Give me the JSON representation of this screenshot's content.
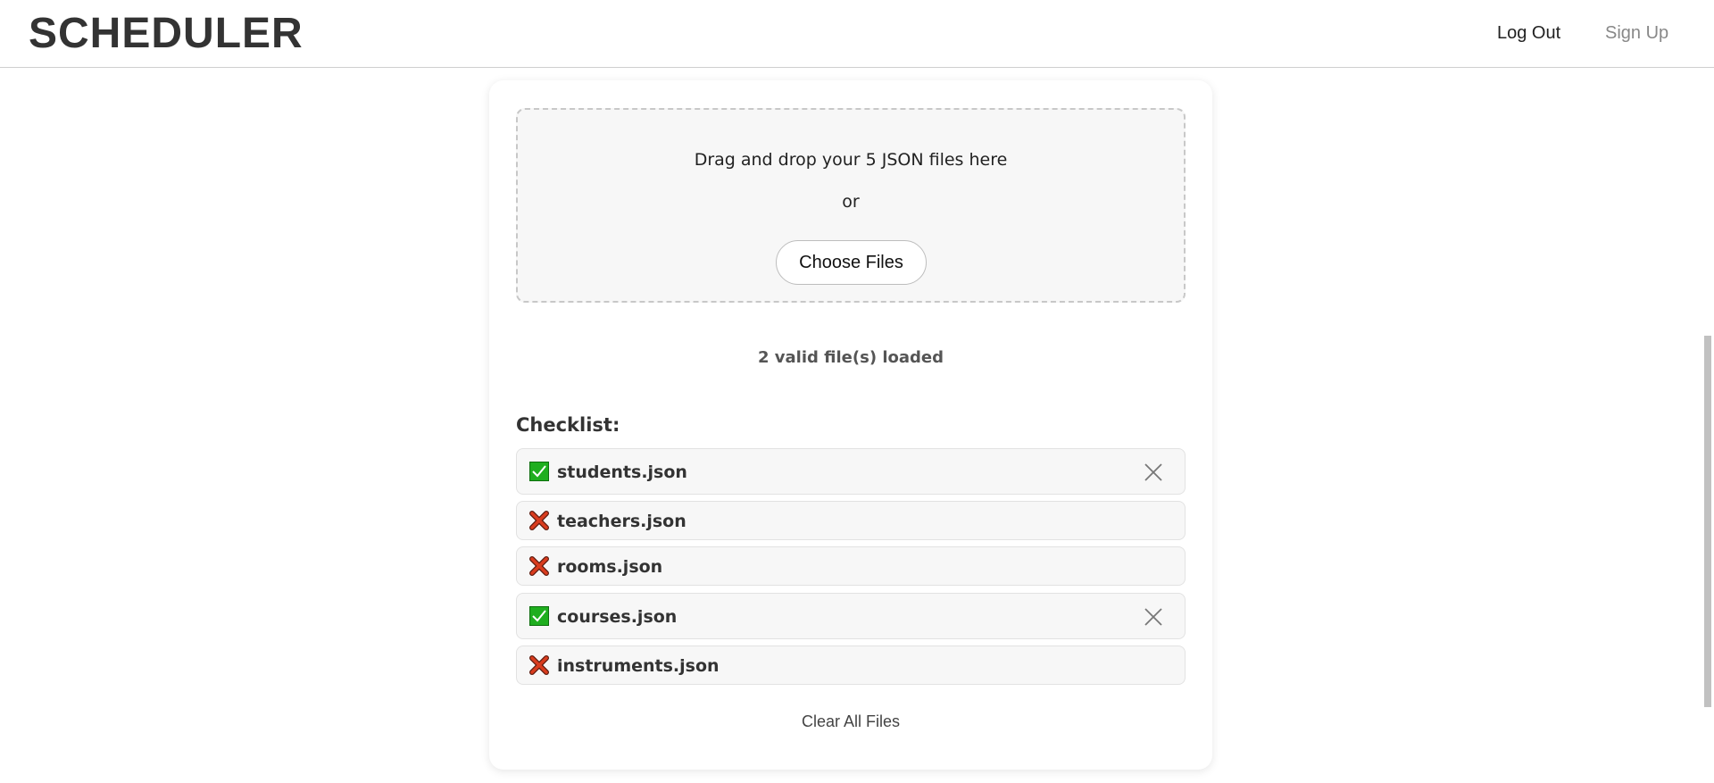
{
  "header": {
    "logo": "SCHEDULER",
    "logout_label": "Log Out",
    "signup_label": "Sign Up"
  },
  "upload": {
    "drop_text": "Drag and drop your 5 JSON files here",
    "or_text": "or",
    "choose_label": "Choose Files",
    "status_text": "2 valid file(s) loaded"
  },
  "checklist": {
    "title": "Checklist:",
    "items": [
      {
        "name": "students.json",
        "status": "valid",
        "icon": "check-icon"
      },
      {
        "name": "teachers.json",
        "status": "missing",
        "icon": "cross-icon"
      },
      {
        "name": "rooms.json",
        "status": "missing",
        "icon": "cross-icon"
      },
      {
        "name": "courses.json",
        "status": "valid",
        "icon": "check-icon"
      },
      {
        "name": "instruments.json",
        "status": "missing",
        "icon": "cross-icon"
      }
    ],
    "clear_label": "Clear All Files"
  },
  "colors": {
    "check_green": "#1fae1f",
    "cross_red": "#d93c1e"
  }
}
